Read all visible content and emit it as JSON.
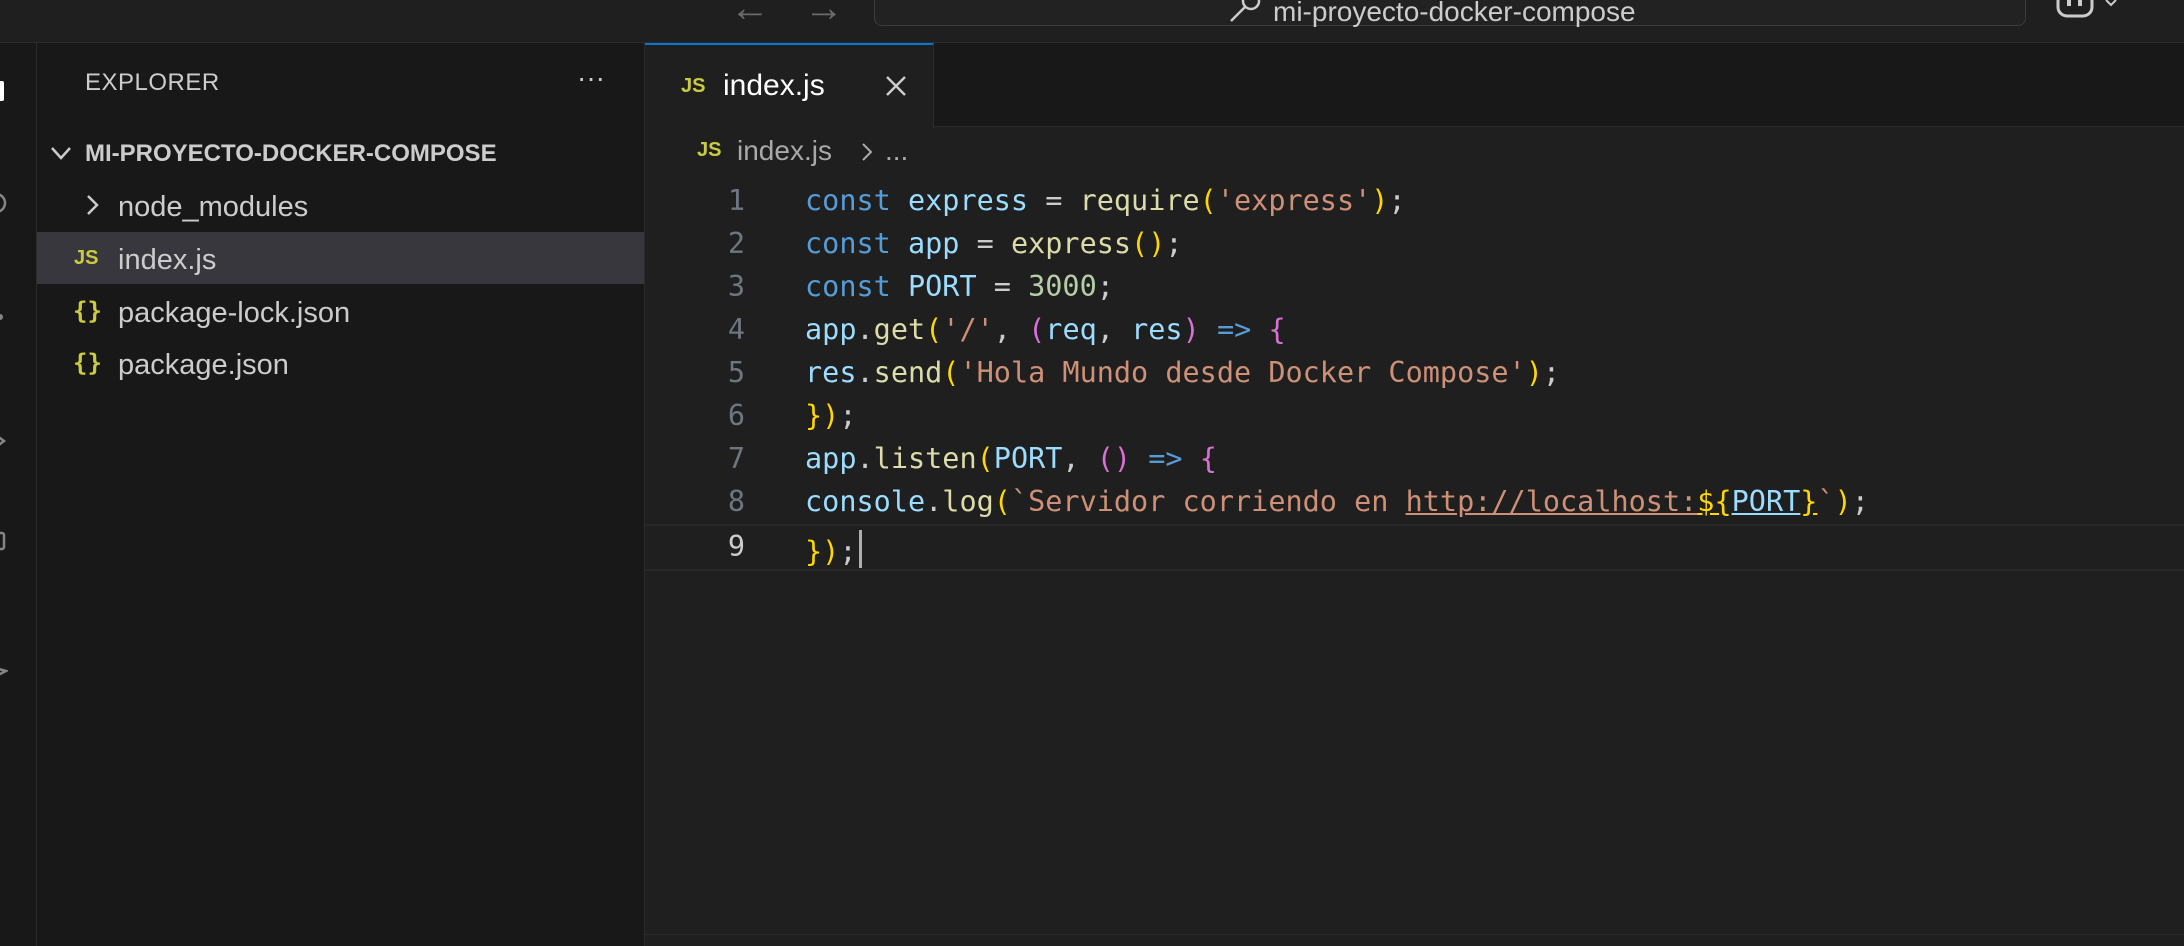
{
  "titlebar": {
    "search_text": "mi-proyecto-docker-compose"
  },
  "sidebar": {
    "title": "EXPLORER",
    "folder_name": "MI-PROYECTO-DOCKER-COMPOSE",
    "items": [
      {
        "label": "node_modules",
        "icon": "chevron-right-icon"
      },
      {
        "label": "index.js",
        "badge": "JS",
        "icon": "js-file-icon"
      },
      {
        "label": "package-lock.json",
        "badge": "{}",
        "icon": "json-file-icon"
      },
      {
        "label": "package.json",
        "badge": "{}",
        "icon": "json-file-icon"
      }
    ]
  },
  "editor": {
    "tab": {
      "badge": "JS",
      "label": "index.js"
    },
    "breadcrumb": {
      "badge": "JS",
      "file": "index.js",
      "more": "..."
    },
    "lines": [
      {
        "num": "1",
        "code": "const express = require('express');"
      },
      {
        "num": "2",
        "code": "const app = express();"
      },
      {
        "num": "3",
        "code": "const PORT = 3000;"
      },
      {
        "num": "4",
        "code": "app.get('/', (req, res) => {"
      },
      {
        "num": "5",
        "code": "res.send('Hola Mundo desde Docker Compose');"
      },
      {
        "num": "6",
        "code": "});"
      },
      {
        "num": "7",
        "code": "app.listen(PORT, () => {"
      },
      {
        "num": "8",
        "code": "console.log(`Servidor corriendo en http://localhost:${PORT}`);"
      },
      {
        "num": "9",
        "code": "});"
      }
    ],
    "active_line": 9
  },
  "colors": {
    "keyword": "#569cd6",
    "variable": "#9cdcfe",
    "function": "#dcdcaa",
    "string": "#ce9178",
    "number": "#b5cea8",
    "bracket1": "#ffd700",
    "bracket2": "#da70d6",
    "bracket3": "#179fff",
    "accent": "#0078d4"
  }
}
